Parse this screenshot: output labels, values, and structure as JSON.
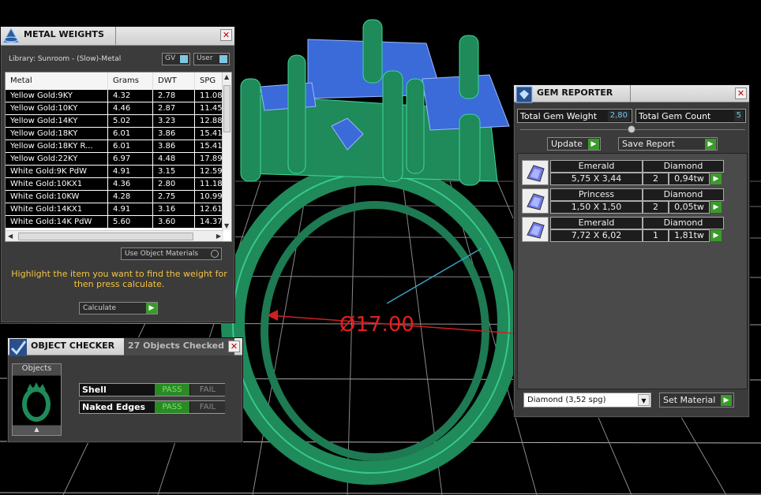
{
  "viewport": {
    "dimension_label": "Ø17.00"
  },
  "metal_weights": {
    "title": "METAL WEIGHTS",
    "library": "Library: Sunroom - (Slow)-Metal",
    "toggle_gv": "GV",
    "toggle_user": "User",
    "columns": [
      "Metal",
      "Grams",
      "DWT",
      "SPG"
    ],
    "rows": [
      [
        "Yellow Gold:9KY",
        "4.32",
        "2.78",
        "11.08"
      ],
      [
        "Yellow Gold:10KY",
        "4.46",
        "2.87",
        "11.45"
      ],
      [
        "Yellow Gold:14KY",
        "5.02",
        "3.23",
        "12.88"
      ],
      [
        "Yellow Gold:18KY",
        "6.01",
        "3.86",
        "15.41"
      ],
      [
        "Yellow Gold:18KY R...",
        "6.01",
        "3.86",
        "15.41"
      ],
      [
        "Yellow Gold:22KY",
        "6.97",
        "4.48",
        "17.89"
      ],
      [
        "White Gold:9K PdW",
        "4.91",
        "3.15",
        "12.59"
      ],
      [
        "White Gold:10KX1",
        "4.36",
        "2.80",
        "11.18"
      ],
      [
        "White Gold:10KW",
        "4.28",
        "2.75",
        "10.99"
      ],
      [
        "White Gold:14KX1",
        "4.91",
        "3.16",
        "12.61"
      ],
      [
        "White Gold:14K PdW",
        "5.60",
        "3.60",
        "14.37"
      ]
    ],
    "use_object_materials": "Use Object Materials",
    "hint": "Highlight the item you want to find the weight for then press calculate.",
    "calculate": "Calculate"
  },
  "object_checker": {
    "title": "OBJECT CHECKER",
    "status": "27 Objects Checked",
    "objects_label": "Objects",
    "checks": [
      {
        "name": "Shell",
        "pass": "PASS",
        "fail": "FAIL"
      },
      {
        "name": "Naked Edges",
        "pass": "PASS",
        "fail": "FAIL"
      }
    ]
  },
  "gem_reporter": {
    "title": "GEM REPORTER",
    "total_weight_label": "Total Gem Weight",
    "total_weight": "2,80",
    "total_count_label": "Total Gem Count",
    "total_count": "5",
    "update": "Update",
    "save_report": "Save Report",
    "gems": [
      {
        "cut": "Emerald",
        "size": "5,75 X 3,44",
        "material": "Diamond",
        "qty": "2",
        "weight": "0,94tw"
      },
      {
        "cut": "Princess",
        "size": "1,50 X 1,50",
        "material": "Diamond",
        "qty": "2",
        "weight": "0,05tw"
      },
      {
        "cut": "Emerald",
        "size": "7,72 X 6,02",
        "material": "Diamond",
        "qty": "1",
        "weight": "1,81tw"
      }
    ],
    "material_select": "Diamond    (3,52 spg)",
    "set_material": "Set Material"
  }
}
